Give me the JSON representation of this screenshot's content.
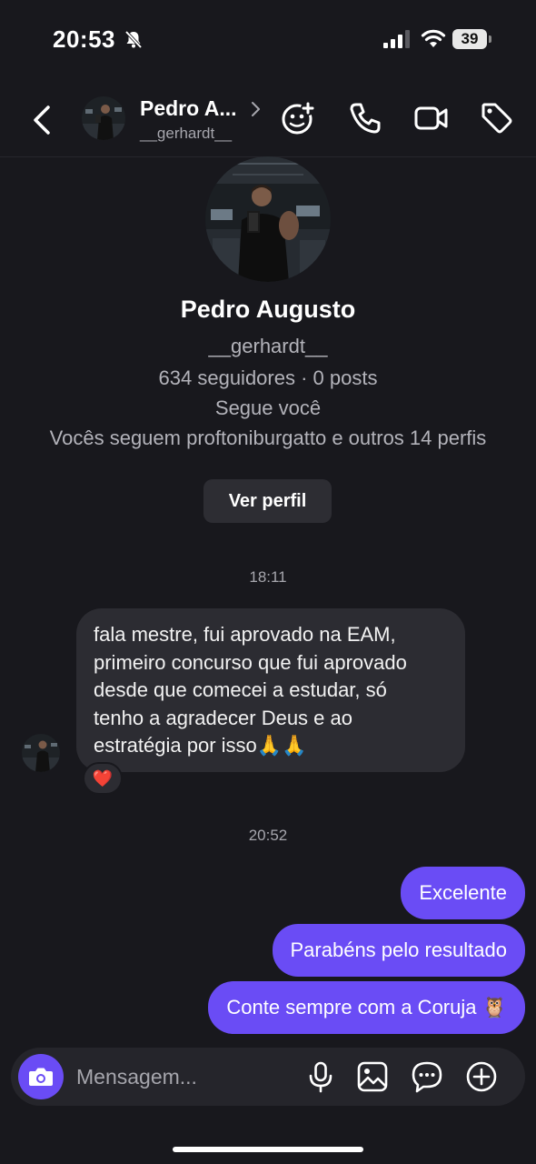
{
  "status_bar": {
    "time": "20:53",
    "battery": "39"
  },
  "header": {
    "name": "Pedro A...",
    "username": "__gerhardt__",
    "icons": [
      "back-icon",
      "chevron-right-icon",
      "game-controller-icon",
      "phone-icon",
      "video-icon",
      "tag-icon"
    ]
  },
  "profile": {
    "name": "Pedro Augusto",
    "username": "__gerhardt__",
    "stats": "634 seguidores · 0 posts",
    "follows_you": "Segue você",
    "mutual": "Vocês seguem proftoniburgatto e outros 14 perfis",
    "view_profile_label": "Ver perfil"
  },
  "conversation": {
    "time_1": "18:11",
    "incoming": {
      "text": "fala mestre, fui aprovado na EAM,\nprimeiro concurso que fui aprovado\ndesde que comecei a estudar, só\ntenho a agradecer Deus e ao\nestratégia por isso🙏🙏",
      "reaction": "❤️"
    },
    "time_2": "20:52",
    "outgoing": [
      {
        "text": "Excelente"
      },
      {
        "text": "Parabéns pelo resultado"
      },
      {
        "text": "Conte sempre com a Coruja 🦉"
      }
    ]
  },
  "composer": {
    "placeholder": "Mensagem...",
    "icons": [
      "camera-icon",
      "microphone-icon",
      "gallery-icon",
      "sticker-icon",
      "plus-icon"
    ]
  },
  "colors": {
    "accent": "#6a4cf5",
    "background": "#18181d",
    "bubble_in": "#2c2c32"
  }
}
